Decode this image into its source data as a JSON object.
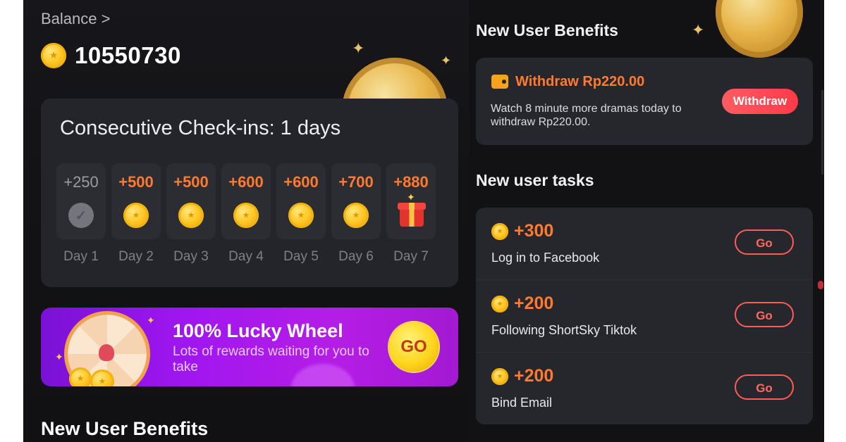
{
  "balance": {
    "label": "Balance >",
    "value": "10550730",
    "icon": "coin-icon"
  },
  "checkin": {
    "title": "Consecutive Check-ins: 1 days",
    "days": [
      {
        "amount": "+250",
        "label": "Day 1",
        "state": "claimed",
        "icon": "check-icon"
      },
      {
        "amount": "+500",
        "label": "Day 2",
        "state": "pending",
        "icon": "coin-icon"
      },
      {
        "amount": "+500",
        "label": "Day 3",
        "state": "pending",
        "icon": "coin-icon"
      },
      {
        "amount": "+600",
        "label": "Day 4",
        "state": "pending",
        "icon": "coin-icon"
      },
      {
        "amount": "+600",
        "label": "Day 5",
        "state": "pending",
        "icon": "coin-icon"
      },
      {
        "amount": "+700",
        "label": "Day 6",
        "state": "pending",
        "icon": "coin-icon"
      },
      {
        "amount": "+880",
        "label": "Day 7",
        "state": "pending",
        "icon": "gift-icon"
      }
    ]
  },
  "lucky_wheel": {
    "title": "100% Lucky Wheel",
    "subtitle": "Lots of rewards waiting for you to take",
    "button_label": "GO"
  },
  "left_bottom_heading": "New User Benefits",
  "right": {
    "benefits_heading": "New User Benefits",
    "withdraw": {
      "title": "Withdraw Rp220.00",
      "description": "Watch 8 minute more dramas today to withdraw Rp220.00.",
      "button_label": "Withdraw"
    },
    "tasks_heading": "New user tasks",
    "tasks": [
      {
        "reward": "+300",
        "name": "Log in to Facebook",
        "button_label": "Go"
      },
      {
        "reward": "+200",
        "name": "Following ShortSky Tiktok",
        "button_label": "Go"
      },
      {
        "reward": "+200",
        "name": "Bind Email",
        "button_label": "Go"
      }
    ]
  },
  "colors": {
    "accent_orange": "#ff7a2e",
    "withdraw_red": "#ff4a55",
    "banner_purple": "#a016f0",
    "coin_gold": "#ffc928",
    "card_bg": "#24252b"
  }
}
